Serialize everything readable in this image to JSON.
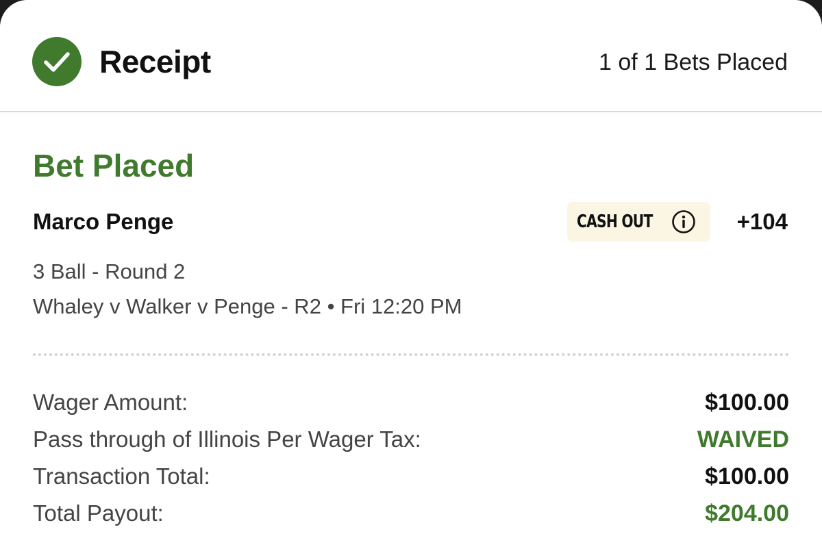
{
  "header": {
    "title": "Receipt",
    "bets_count": "1 of 1 Bets Placed",
    "status_icon": "check-circle-icon",
    "accent_color": "#3f7a2d"
  },
  "bet": {
    "status": "Bet Placed",
    "selection": "Marco Penge",
    "cash_out_label": "CASH OUT",
    "cash_out_icon": "info-icon",
    "odds": "+104",
    "market": "3 Ball - Round 2",
    "event": "Whaley v Walker v Penge - R2",
    "separator": "•",
    "time": "Fri 12:20 PM"
  },
  "summary": [
    {
      "label": "Wager Amount:",
      "value": "$100.00",
      "value_color": "#111111"
    },
    {
      "label": "Pass through of Illinois Per Wager Tax:",
      "value": "WAIVED",
      "value_color": "#3f7a2d"
    },
    {
      "label": "Transaction Total:",
      "value": "$100.00",
      "value_color": "#111111"
    },
    {
      "label": "Total Payout:",
      "value": "$204.00",
      "value_color": "#3f7a2d"
    }
  ]
}
